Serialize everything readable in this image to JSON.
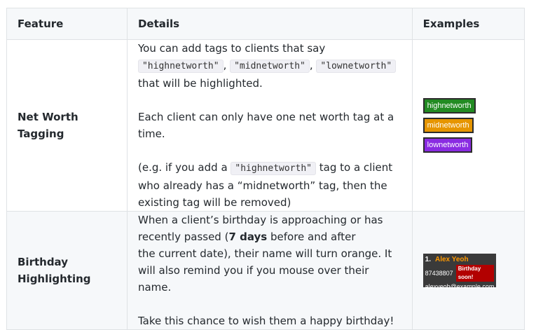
{
  "table": {
    "headers": [
      "Feature",
      "Details",
      "Examples"
    ],
    "rows": [
      {
        "feature": "Net Worth Tagging",
        "details": {
          "p1_pre": "You can add tags to clients that say ",
          "code1": "\"highnetworth\"",
          "sep1": ", ",
          "code2": "\"midnetworth\"",
          "sep2": ", ",
          "code3": "\"lownetworth\"",
          "p1_post": " that will be highlighted.",
          "p2": "Each client can only have one net worth tag at a time.",
          "p3_pre": "(e.g. if you add a ",
          "code4": "\"highnetworth\"",
          "p3_post": " tag to a client who already has a “midnetworth” tag, then the existing tag will be removed)"
        },
        "examples": {
          "tags": [
            {
              "label": "highnetworth",
              "color": "#228b22"
            },
            {
              "label": "midnetworth",
              "color": "#e69500"
            },
            {
              "label": "lownetworth",
              "color": "#8a2be2"
            }
          ]
        }
      },
      {
        "feature": "Birthday Highlighting",
        "details": {
          "p1_pre": "When a client’s birthday is approaching or has recently passed (",
          "p1_bold": "7 days",
          "p1_mid": " before and after",
          "p1_post": "the current date), their name will turn orange. It will also remind you if you mouse over their name.",
          "p2": "Take this chance to wish them a happy birthday!"
        },
        "examples": {
          "card": {
            "index": "1.",
            "name": "Alex Yeoh",
            "phone": "87438807",
            "badge": "Birthday soon!",
            "email": "alexyeoh@example.com",
            "name_color": "#ff9900",
            "badge_color": "#b20000"
          }
        }
      }
    ]
  }
}
